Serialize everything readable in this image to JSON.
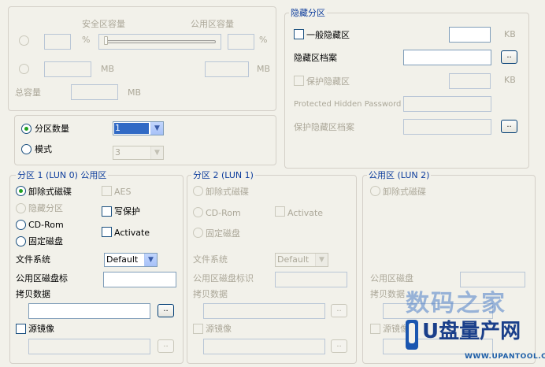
{
  "capacity": {
    "safe_label": "安全区容量",
    "public_label": "公用区容量",
    "percent_unit": "%",
    "mb_unit": "MB",
    "total_label": "总容量"
  },
  "partition_count": {
    "count_label": "分区数量",
    "count_value": "1",
    "mode_label": "模式",
    "mode_value": "3"
  },
  "hidden": {
    "title": "隐藏分区",
    "normal_hidden_label": "一般隐藏区",
    "kb_unit": "KB",
    "hidden_file_label": "隐藏区档案",
    "browse": "..",
    "protect_hidden_label": "保护隐藏区",
    "protected_password_label": "Protected Hidden Password",
    "protect_file_label": "保护隐藏区档案"
  },
  "partition1": {
    "title": "分区 1 (LUN 0) 公用区",
    "removable": "卸除式磁碟",
    "aes": "AES",
    "hidden": "隐藏分区",
    "write_protect": "写保护",
    "cdrom": "CD-Rom",
    "activate": "Activate",
    "fixed": "固定磁盘",
    "fs_label": "文件系统",
    "fs_value": "Default",
    "volume_label": "公用区磁盘标",
    "copy_label": "拷贝数据",
    "browse": "..",
    "mirror_label": "源镜像"
  },
  "partition2": {
    "title": "分区 2 (LUN 1)",
    "removable": "卸除式磁碟",
    "cdrom": "CD-Rom",
    "activate": "Activate",
    "fixed": "固定磁盘",
    "fs_label": "文件系统",
    "fs_value": "Default",
    "volume_label": "公用区磁盘标识",
    "copy_label": "拷贝数据",
    "browse": "..",
    "mirror_label": "源镜像"
  },
  "public_area": {
    "title": "公用区 (LUN 2)",
    "removable": "卸除式磁碟",
    "volume_label": "公用区磁盘",
    "copy_label": "拷贝数据",
    "mirror_label": "源镜像"
  },
  "watermark": {
    "brand": "数码之家",
    "logo_text": "U盘量产网",
    "url": "WWW.UPANTOOL.COM"
  }
}
